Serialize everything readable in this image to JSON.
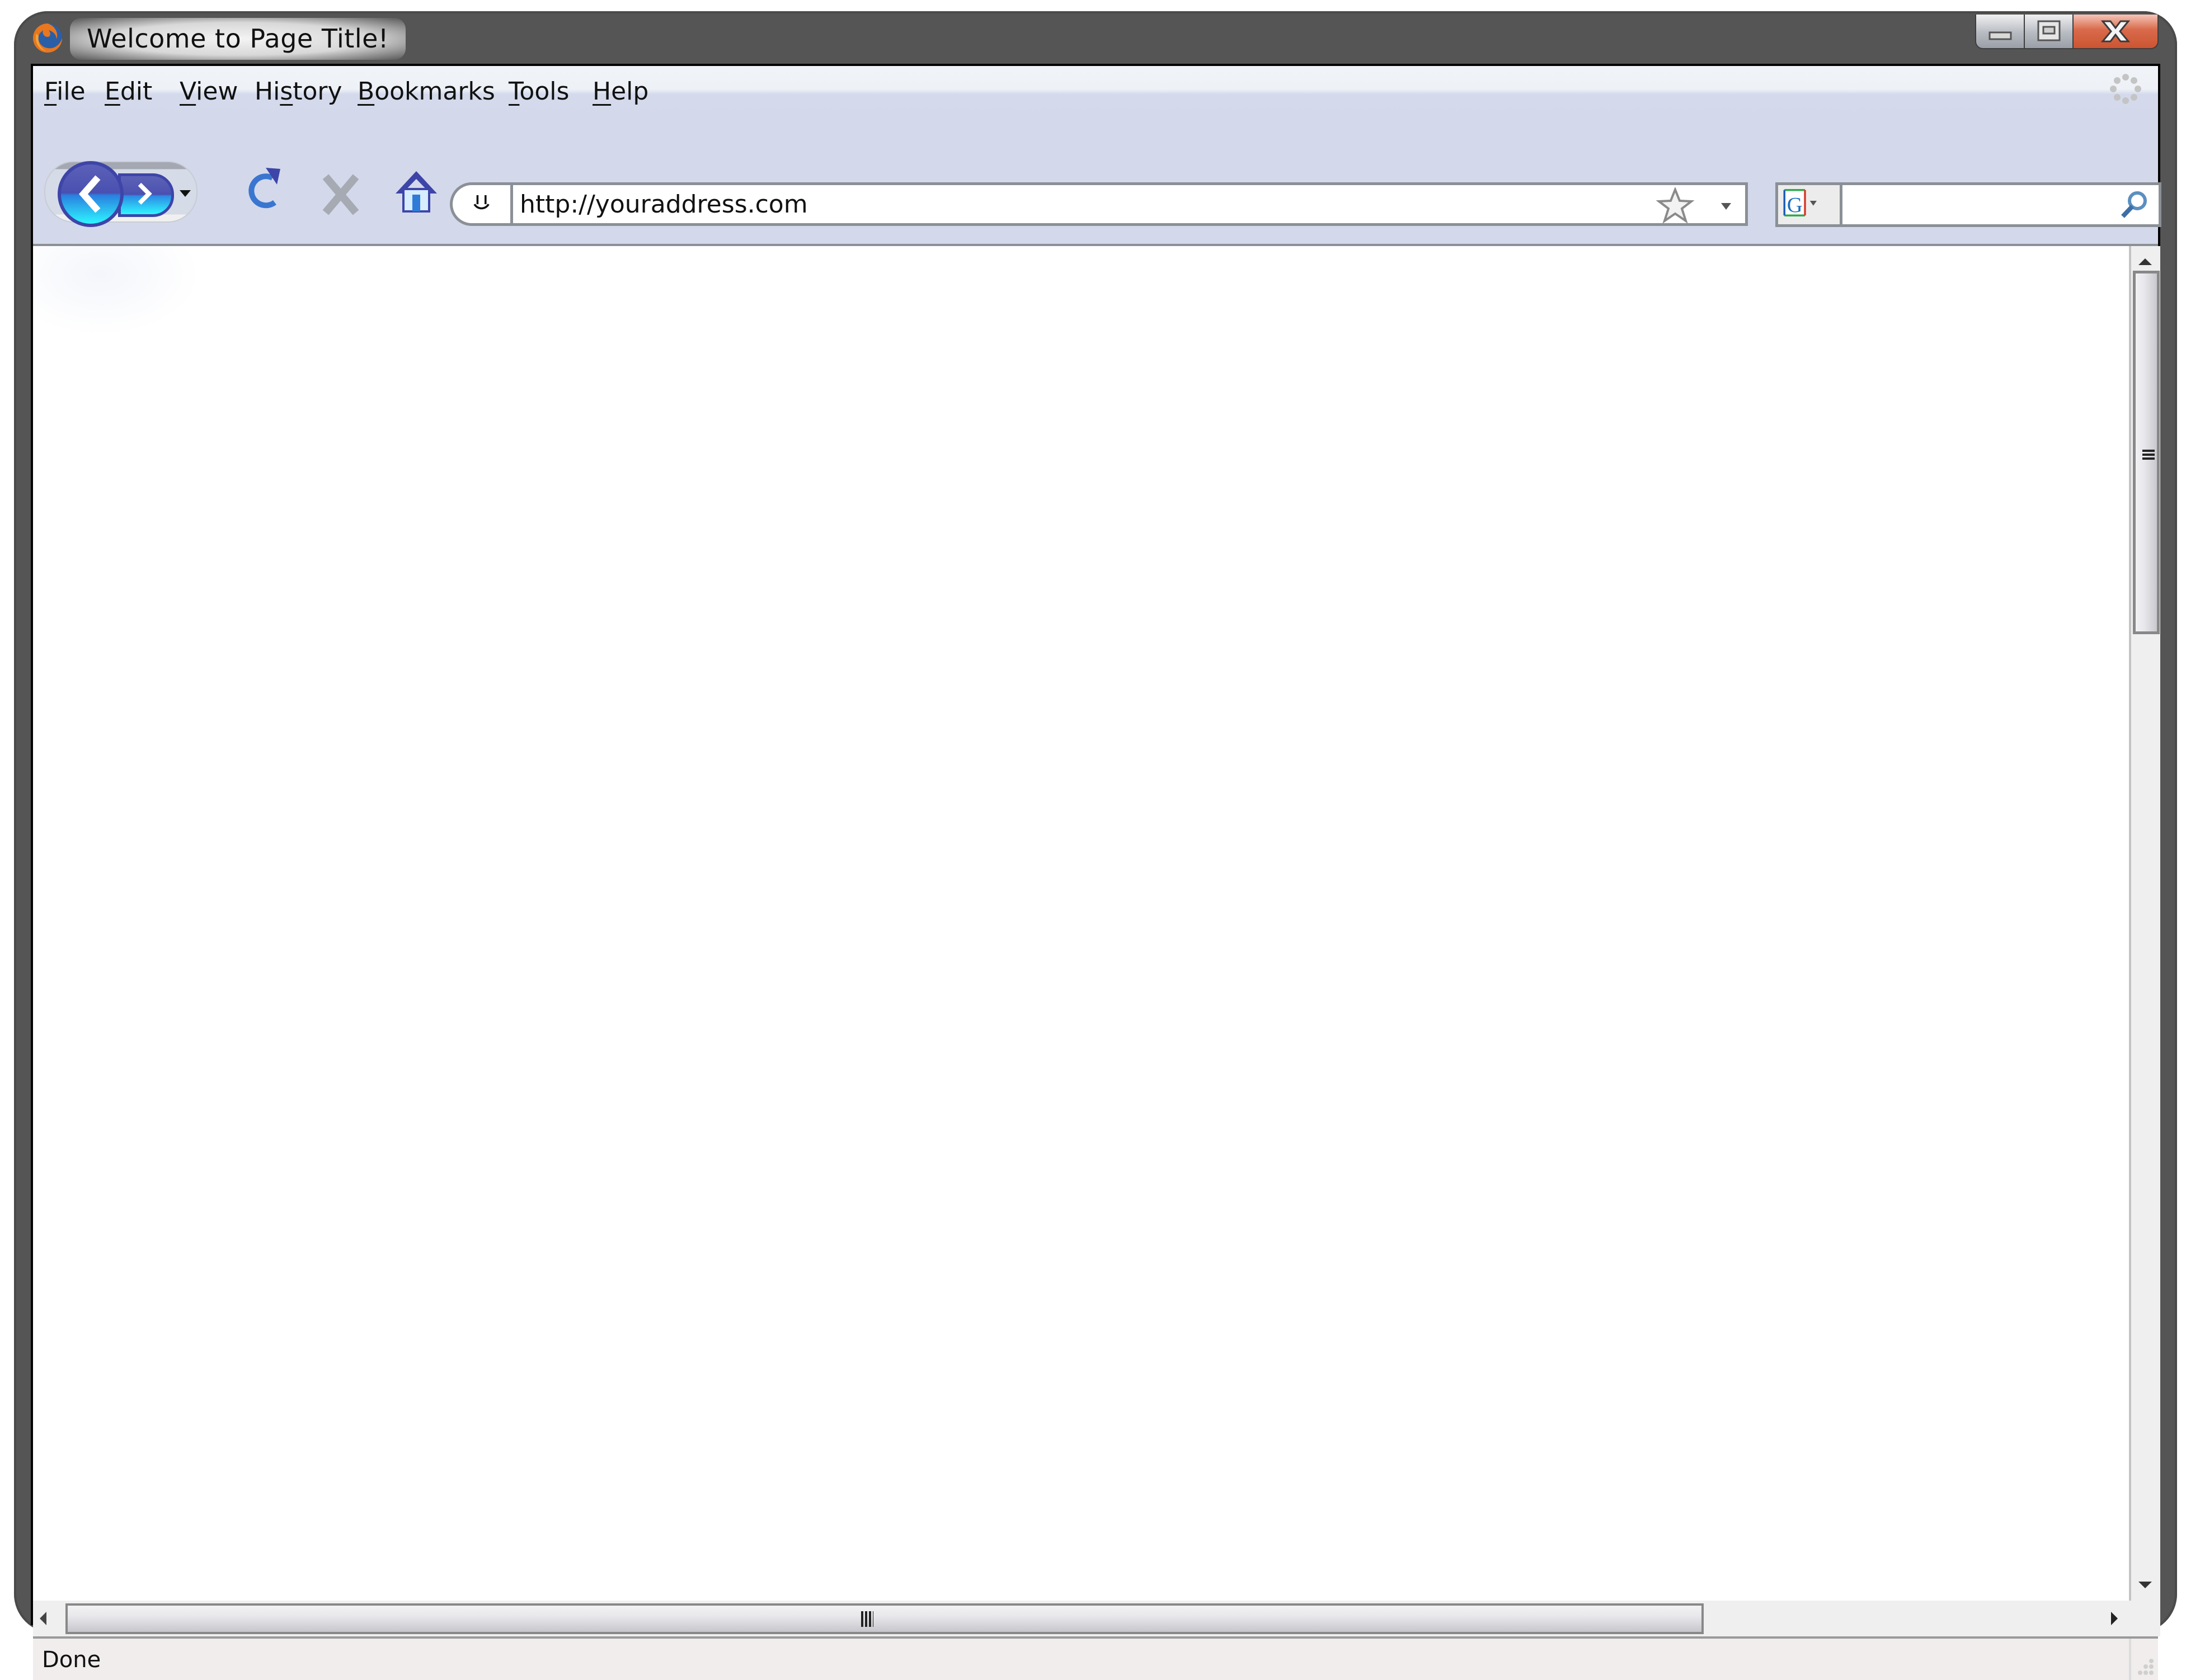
{
  "window": {
    "title": "Welcome to Page Title!",
    "app_icon": "firefox-logo-icon",
    "controls": {
      "minimize": "minimize-icon",
      "maximize": "maximize-icon",
      "close": "close-icon"
    },
    "close_color": "#cc5532"
  },
  "menubar": {
    "items": [
      {
        "accel": "F",
        "rest": "ile"
      },
      {
        "accel": "E",
        "rest": "dit"
      },
      {
        "accel": "V",
        "rest": "iew"
      },
      {
        "pre": "Hi",
        "accel": "s",
        "rest": "tory"
      },
      {
        "accel": "B",
        "rest": "ookmarks"
      },
      {
        "accel": "T",
        "rest": "ools"
      },
      {
        "accel": "H",
        "rest": "elp"
      }
    ],
    "activity_indicator": "throbber-icon"
  },
  "toolbar": {
    "back": "back-arrow-icon",
    "forward": "forward-arrow-icon",
    "history_dropdown": "chevron-down-icon",
    "reload": "reload-icon",
    "stop": "stop-icon",
    "home": "home-icon",
    "accent": "#3d45a8"
  },
  "address_bar": {
    "site_identity": "site-identity-icon",
    "url": "http://youraddress.com",
    "bookmark": "star-icon",
    "dropdown": "chevron-down-icon"
  },
  "search_bar": {
    "engine": "G",
    "engine_icon": "google-icon",
    "value": "",
    "placeholder": "",
    "go": "magnifier-icon"
  },
  "content": {
    "page_body": ""
  },
  "scrollbars": {
    "vertical": {
      "up": "arrow-up-icon",
      "down": "arrow-down-icon"
    },
    "horizontal": {
      "left": "arrow-left-icon",
      "right": "arrow-right-icon"
    }
  },
  "statusbar": {
    "text": "Done",
    "resize": "resize-grip-icon"
  }
}
